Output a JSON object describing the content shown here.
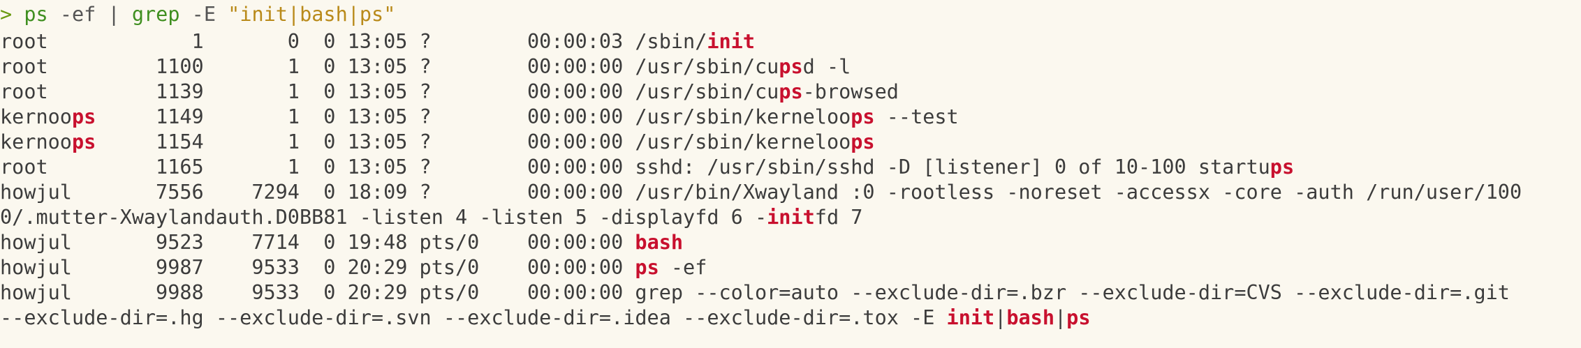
{
  "command": {
    "prompt": ">",
    "program": "ps",
    "args": "-ef",
    "pipe": "|",
    "filter_program": "grep",
    "filter_flag": "-E",
    "pattern": "\"init|bash|ps\""
  },
  "lines": [
    [
      {
        "t": "root            1       0  0 13:05 ?        00:00:03 /sbin/"
      },
      {
        "t": "init",
        "hl": true
      }
    ],
    [
      {
        "t": "root         1100       1  0 13:05 ?        00:00:00 /usr/sbin/cu"
      },
      {
        "t": "ps",
        "hl": true
      },
      {
        "t": "d -l"
      }
    ],
    [
      {
        "t": "root         1139       1  0 13:05 ?        00:00:00 /usr/sbin/cu"
      },
      {
        "t": "ps",
        "hl": true
      },
      {
        "t": "-browsed"
      }
    ],
    [
      {
        "t": "kernoo"
      },
      {
        "t": "ps",
        "hl": true
      },
      {
        "t": "     1149       1  0 13:05 ?        00:00:00 /usr/sbin/kerneloo"
      },
      {
        "t": "ps",
        "hl": true
      },
      {
        "t": " --test"
      }
    ],
    [
      {
        "t": "kernoo"
      },
      {
        "t": "ps",
        "hl": true
      },
      {
        "t": "     1154       1  0 13:05 ?        00:00:00 /usr/sbin/kerneloo"
      },
      {
        "t": "ps",
        "hl": true
      }
    ],
    [
      {
        "t": "root         1165       1  0 13:05 ?        00:00:00 sshd: /usr/sbin/sshd -D [listener] 0 of 10-100 startu"
      },
      {
        "t": "ps",
        "hl": true
      }
    ],
    [
      {
        "t": "howjul       7556    7294  0 18:09 ?        00:00:00 /usr/bin/Xwayland :0 -rootless -noreset -accessx -core -auth /run/user/100"
      }
    ],
    [
      {
        "t": "0/.mutter-Xwaylandauth.D0BB81 -listen 4 -listen 5 -displayfd 6 -"
      },
      {
        "t": "init",
        "hl": true
      },
      {
        "t": "fd 7"
      }
    ],
    [
      {
        "t": "howjul       9523    7714  0 19:48 pts/0    00:00:00 "
      },
      {
        "t": "bash",
        "hl": true
      }
    ],
    [
      {
        "t": "howjul       9987    9533  0 20:29 pts/0    00:00:00 "
      },
      {
        "t": "ps",
        "hl": true
      },
      {
        "t": " -ef"
      }
    ],
    [
      {
        "t": "howjul       9988    9533  0 20:29 pts/0    00:00:00 grep --color=auto --exclude-dir=.bzr --exclude-dir=CVS --exclude-dir=.git"
      }
    ],
    [
      {
        "t": "--exclude-dir=.hg --exclude-dir=.svn --exclude-dir=.idea --exclude-dir=.tox -E "
      },
      {
        "t": "init",
        "hl": true
      },
      {
        "t": "|"
      },
      {
        "t": "bash",
        "hl": true
      },
      {
        "t": "|"
      },
      {
        "t": "ps",
        "hl": true
      }
    ]
  ]
}
